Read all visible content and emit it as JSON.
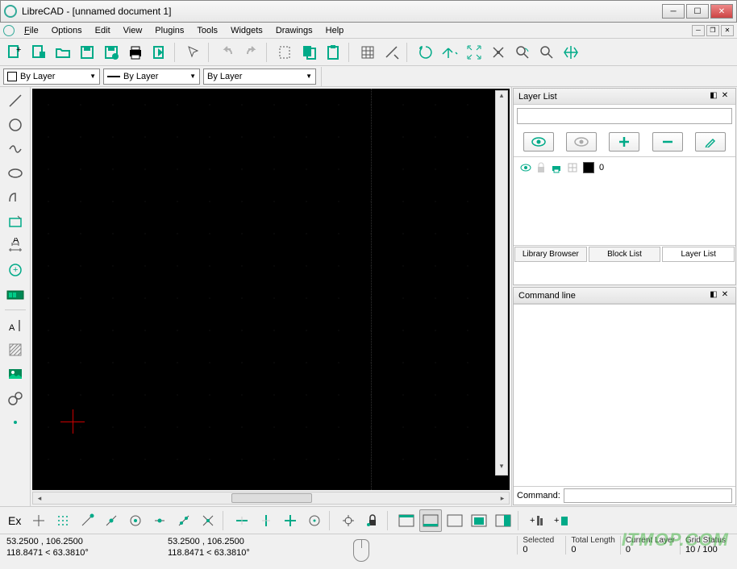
{
  "app": {
    "title": "LibreCAD - [unnamed document 1]"
  },
  "menu": {
    "file": "File",
    "options": "Options",
    "edit": "Edit",
    "view": "View",
    "plugins": "Plugins",
    "tools": "Tools",
    "widgets": "Widgets",
    "drawings": "Drawings",
    "help": "Help"
  },
  "props": {
    "color_label": "By Layer",
    "width_label": "By Layer",
    "linetype_label": "By Layer"
  },
  "tabs": {
    "library": "Library Browser",
    "block": "Block List",
    "layer": "Layer List"
  },
  "panels": {
    "layerlist_title": "Layer List",
    "commandline_title": "Command line",
    "cmd_prompt": "Command:",
    "layer0_name": "0"
  },
  "status": {
    "abs_coords": "53.2500 , 106.2500",
    "rel_coords": "118.8471 < 63.3810°",
    "abs_coords2": "53.2500 , 106.2500",
    "rel_coords2": "118.8471 < 63.3810°",
    "selected_label": "Selected",
    "selected_val": "0",
    "total_label": "Total Length",
    "total_val": "0",
    "curlayer_label": "Current Layer",
    "curlayer_val": "0",
    "grid_label": "Grid Status",
    "grid_val": "10 / 100"
  },
  "ex_label": "Ex",
  "watermark": "ITMOP.COM"
}
